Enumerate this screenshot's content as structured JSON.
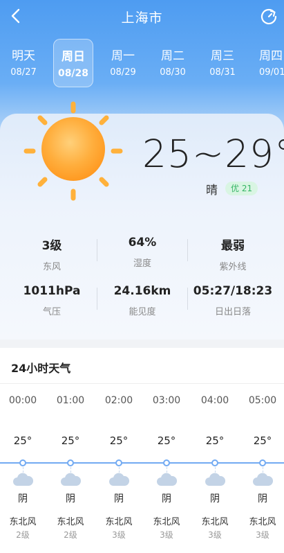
{
  "header": {
    "city": "上海市",
    "back_icon": "chevron-left-icon",
    "refresh_icon": "refresh-icon"
  },
  "days": [
    {
      "name": "明天",
      "date": "08/27"
    },
    {
      "name": "周日",
      "date": "08/28",
      "selected": true
    },
    {
      "name": "周一",
      "date": "08/29"
    },
    {
      "name": "周二",
      "date": "08/30"
    },
    {
      "name": "周三",
      "date": "08/31"
    },
    {
      "name": "周四",
      "date": "09/01"
    }
  ],
  "current": {
    "weather_icon": "sun-icon",
    "temp_range": "25~29°",
    "condition": "晴",
    "aqi": "优 21"
  },
  "metrics": [
    {
      "value": "3级",
      "label": "东风"
    },
    {
      "value": "64%",
      "label": "湿度"
    },
    {
      "value": "最弱",
      "label": "紫外线"
    },
    {
      "value": "1011hPa",
      "label": "气压"
    },
    {
      "value": "24.16km",
      "label": "能见度"
    },
    {
      "value": "05:27/18:23",
      "label": "日出日落"
    }
  ],
  "hourly": {
    "title": "24小时天气",
    "items": [
      {
        "time": "00:00",
        "temp": "25°",
        "icon": "cloud-icon",
        "condition": "阴",
        "wind": "东北风",
        "level": "2级"
      },
      {
        "time": "01:00",
        "temp": "25°",
        "icon": "cloud-icon",
        "condition": "阴",
        "wind": "东北风",
        "level": "2级"
      },
      {
        "time": "02:00",
        "temp": "25°",
        "icon": "cloud-icon",
        "condition": "阴",
        "wind": "东北风",
        "level": "3级"
      },
      {
        "time": "03:00",
        "temp": "25°",
        "icon": "cloud-icon",
        "condition": "阴",
        "wind": "东北风",
        "level": "3级"
      },
      {
        "time": "04:00",
        "temp": "25°",
        "icon": "cloud-icon",
        "condition": "阴",
        "wind": "东北风",
        "level": "3级"
      },
      {
        "time": "05:00",
        "temp": "25°",
        "icon": "cloud-icon",
        "condition": "阴",
        "wind": "东北风",
        "level": "3级"
      }
    ]
  },
  "colors": {
    "header_blue": "#4e9cf1",
    "accent_line": "#72aaf2",
    "aqi_green": "#36b565",
    "sun_orange": "#ffa726"
  }
}
